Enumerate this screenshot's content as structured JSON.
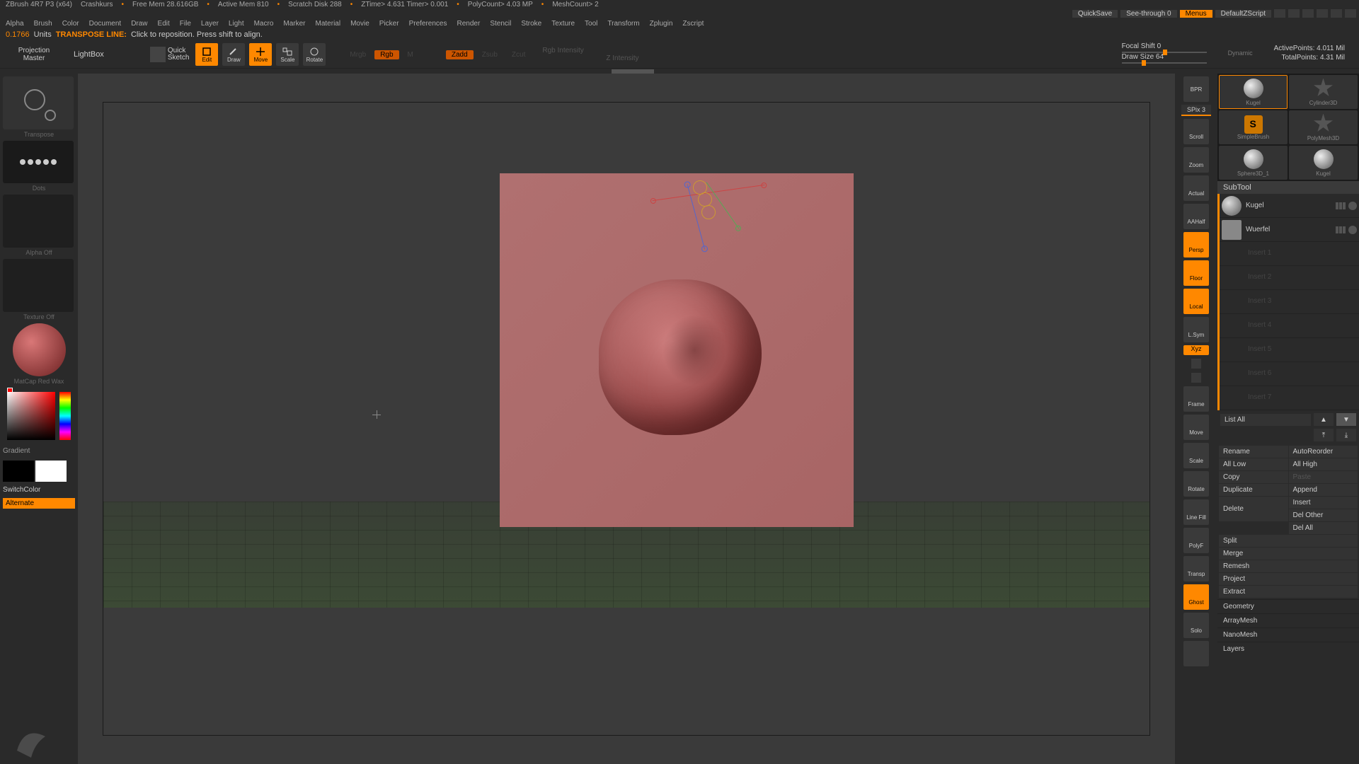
{
  "titlebar": {
    "app": "ZBrush 4R7 P3 (x64)",
    "doc": "Crashkurs",
    "stats": [
      "Free Mem 28.616GB",
      "Active Mem 810",
      "Scratch Disk 288",
      "ZTime> 4.631  Timer> 0.001",
      "PolyCount> 4.03 MP",
      "MeshCount> 2"
    ]
  },
  "toprow": {
    "quicksave": "QuickSave",
    "seethrough": "See-through  0",
    "menus": "Menus",
    "script": "DefaultZScript"
  },
  "menus": [
    "Alpha",
    "Brush",
    "Color",
    "Document",
    "Draw",
    "Edit",
    "File",
    "Layer",
    "Light",
    "Macro",
    "Marker",
    "Material",
    "Movie",
    "Picker",
    "Preferences",
    "Render",
    "Stencil",
    "Stroke",
    "Texture",
    "Tool",
    "Transform",
    "Zplugin",
    "Zscript"
  ],
  "hint": {
    "units_value": "0.1766",
    "units_label": "Units",
    "mode": "TRANSPOSE LINE:",
    "text": "Click to reposition. Press shift to align."
  },
  "shelf": {
    "projection_master": "Projection\nMaster",
    "lightbox": "LightBox",
    "quicksketch": "Quick\nSketch",
    "tools": [
      {
        "label": "Edit",
        "active": true
      },
      {
        "label": "Draw",
        "active": false
      },
      {
        "label": "Move",
        "active": true
      },
      {
        "label": "Scale",
        "active": false
      },
      {
        "label": "Rotate",
        "active": false
      }
    ],
    "mode_mrgb": "Mrgb",
    "mode_rgb": "Rgb",
    "mode_m": "M",
    "mode_zadd": "Zadd",
    "mode_zsub": "Zsub",
    "mode_zcut": "Zcut",
    "rgb_intensity": "Rgb Intensity",
    "z_intensity": "Z Intensity",
    "focal": "Focal Shift 0",
    "drawsize": "Draw Size 64",
    "dynamic": "Dynamic",
    "activepts": "ActivePoints: 4.011 Mil",
    "totalpts": "TotalPoints: 4.31 Mil"
  },
  "left": {
    "brush": "Transpose",
    "stroke": "Dots",
    "alpha": "Alpha Off",
    "texture": "Texture Off",
    "material": "MatCap Red Wax",
    "gradient": "Gradient",
    "switchcolor": "SwitchColor",
    "alternate": "Alternate"
  },
  "rightdock": {
    "btns": [
      "BPR",
      "Scroll",
      "Zoom",
      "Actual",
      "AAHalf",
      "Persp",
      "Floor",
      "Local",
      "L.Sym"
    ],
    "spix": "SPix 3",
    "xyz": "Xyz",
    "btns2": [
      "Frame",
      "Move",
      "Scale",
      "Rotate",
      "Line Fill",
      "PolyF",
      "Transp",
      "Ghost",
      "Solo"
    ]
  },
  "toolthumbs": [
    {
      "label": "Kugel"
    },
    {
      "label": "Cylinder3D"
    },
    {
      "label": "SimpleBrush"
    },
    {
      "label": "PolyMesh3D"
    },
    {
      "label": "Sphere3D_1"
    },
    {
      "label": "Kugel"
    }
  ],
  "subtool": {
    "header": "SubTool",
    "items": [
      {
        "name": "Kugel"
      },
      {
        "name": "Wuerfel"
      }
    ],
    "empties": [
      "Insert 1",
      "Insert 2",
      "Insert 3",
      "Insert 4",
      "Insert 5",
      "Insert 6",
      "Insert 7"
    ],
    "listall": "List All",
    "ops": {
      "rename": "Rename",
      "autoreorder": "AutoReorder",
      "alllow": "All Low",
      "allhigh": "All High",
      "copy": "Copy",
      "paste": "Paste",
      "duplicate": "Duplicate",
      "append": "Append",
      "insert": "Insert",
      "delete": "Delete",
      "delother": "Del Other",
      "delall": "Del All",
      "split": "Split",
      "merge": "Merge",
      "remesh": "Remesh",
      "project": "Project",
      "extract": "Extract"
    },
    "sections": [
      "Geometry",
      "ArrayMesh",
      "NanoMesh",
      "Layers"
    ]
  }
}
